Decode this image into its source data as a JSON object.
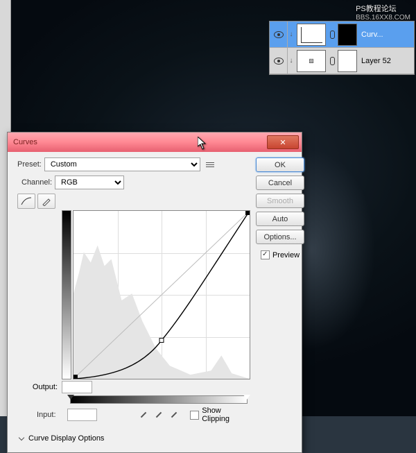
{
  "watermark": {
    "line1": "PS教程论坛",
    "line2": "BBS.16XX8.COM"
  },
  "layers": {
    "items": [
      {
        "name": "Curv...",
        "selected": true
      },
      {
        "name": "Layer 52",
        "selected": false
      }
    ]
  },
  "dialog": {
    "title": "Curves",
    "preset_label": "Preset:",
    "preset_value": "Custom",
    "channel_label": "Channel:",
    "channel_value": "RGB",
    "output_label": "Output:",
    "input_label": "Input:",
    "show_clipping": "Show Clipping",
    "curve_display": "Curve Display Options",
    "buttons": {
      "ok": "OK",
      "cancel": "Cancel",
      "smooth": "Smooth",
      "auto": "Auto",
      "options": "Options..."
    },
    "preview": "Preview",
    "close": "✕"
  },
  "chart_data": {
    "type": "line",
    "title": "Curves",
    "xlabel": "Input",
    "ylabel": "Output",
    "xlim": [
      0,
      255
    ],
    "ylim": [
      0,
      255
    ],
    "series": [
      {
        "name": "identity",
        "x": [
          0,
          255
        ],
        "y": [
          0,
          255
        ]
      },
      {
        "name": "curve",
        "x": [
          0,
          40,
          80,
          128,
          160,
          200,
          230,
          255
        ],
        "y": [
          0,
          8,
          22,
          60,
          100,
          160,
          215,
          255
        ]
      }
    ],
    "histogram": {
      "x_range": [
        0,
        255
      ],
      "peaks_at": [
        15,
        35,
        55,
        80,
        210
      ],
      "dominant_range": [
        0,
        120
      ]
    }
  }
}
